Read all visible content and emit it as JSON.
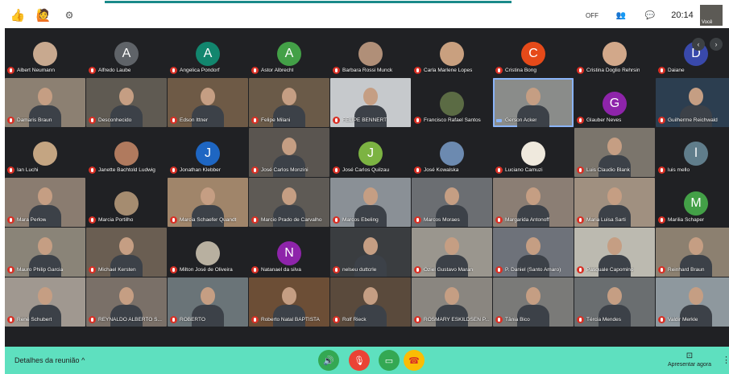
{
  "topbar": {
    "off_label": "OFF",
    "time": "20:14",
    "self_label": "Você"
  },
  "pager": {
    "prev": "‹",
    "next": "›"
  },
  "participants": [
    {
      "name": "Albert Neumann",
      "kind": "photo",
      "color": "#c8a98f"
    },
    {
      "name": "Alfredo Laube",
      "kind": "letter",
      "letter": "A",
      "color": "#5f6368"
    },
    {
      "name": "Angelica Pondorf",
      "kind": "letter",
      "letter": "A",
      "color": "#12866e"
    },
    {
      "name": "Astor Albrecht",
      "kind": "letter",
      "letter": "A",
      "color": "#43a047"
    },
    {
      "name": "Barbara Rossi Munck",
      "kind": "photo",
      "color": "#b08f78"
    },
    {
      "name": "Carla Marlene Lopes",
      "kind": "photo",
      "color": "#c9a07f"
    },
    {
      "name": "Cristina Bong",
      "kind": "letter",
      "letter": "C",
      "color": "#e64a19"
    },
    {
      "name": "Cristina Doglio Rehrsin",
      "kind": "photo",
      "color": "#d2a88a"
    },
    {
      "name": "Daiane",
      "kind": "letter",
      "letter": "D",
      "color": "#3949ab"
    },
    {
      "name": "Damaris Braun",
      "kind": "video",
      "color": "#8c8072"
    },
    {
      "name": "Desconhecido",
      "kind": "video",
      "color": "#5f5a52"
    },
    {
      "name": "Edson Ittner",
      "kind": "video",
      "color": "#6e5a46"
    },
    {
      "name": "Felipe Milani",
      "kind": "video",
      "color": "#6a5a48"
    },
    {
      "name": "FELIPE BENNERT",
      "kind": "video",
      "color": "#c6c9cc"
    },
    {
      "name": "Francisco Rafael Santos",
      "kind": "photo",
      "color": "#5b6b44"
    },
    {
      "name": "Gerson Acker",
      "kind": "video",
      "color": "#8a8c8a",
      "speaking": true
    },
    {
      "name": "Glauber Neves",
      "kind": "letter",
      "letter": "G",
      "color": "#8e24aa"
    },
    {
      "name": "Guilherme Reichwald",
      "kind": "video",
      "color": "#2c3e50"
    },
    {
      "name": "Ian Luchi",
      "kind": "photo",
      "color": "#c4a582"
    },
    {
      "name": "Janette Bachtold Ludwig",
      "kind": "photo",
      "color": "#b07a5e"
    },
    {
      "name": "Jonathan Klebber",
      "kind": "letter",
      "letter": "J",
      "color": "#1e66c2"
    },
    {
      "name": "José Carlos Monzini",
      "kind": "video",
      "color": "#5a5550"
    },
    {
      "name": "José Carlos Quilzau",
      "kind": "letter",
      "letter": "J",
      "color": "#7cb342"
    },
    {
      "name": "José Kowalska",
      "kind": "photo",
      "color": "#6c8ab0"
    },
    {
      "name": "Luciano Camuzi",
      "kind": "photo",
      "color": "#efe9dd"
    },
    {
      "name": "Luis Claudio Blank",
      "kind": "video",
      "color": "#7b756c"
    },
    {
      "name": "luis mello",
      "kind": "letter",
      "letter": "l",
      "color": "#607d8b"
    },
    {
      "name": "Mara Perlow",
      "kind": "video",
      "color": "#8a7c70"
    },
    {
      "name": "Marcia Portilho",
      "kind": "photo",
      "color": "#a58c70"
    },
    {
      "name": "Marcia Schaefer Quandt",
      "kind": "video",
      "color": "#a0856a"
    },
    {
      "name": "Marcio Prado de Carvalho",
      "kind": "video",
      "color": "#5e5a55"
    },
    {
      "name": "Marcos Ebeling",
      "kind": "video",
      "color": "#8a9096"
    },
    {
      "name": "Marcos Moraes",
      "kind": "video",
      "color": "#6b6e72"
    },
    {
      "name": "Margarida Antonoff",
      "kind": "video",
      "color": "#8b7e74"
    },
    {
      "name": "Maria Luisa Sarti",
      "kind": "video",
      "color": "#a09080"
    },
    {
      "name": "Marilia Schaper",
      "kind": "letter",
      "letter": "M",
      "color": "#43a047"
    },
    {
      "name": "Mauro Philip Garcia",
      "kind": "video",
      "color": "#8a8478"
    },
    {
      "name": "Michael Kersten",
      "kind": "video",
      "color": "#6a5e52"
    },
    {
      "name": "Milton José de Oliveira",
      "kind": "photo",
      "color": "#b8b0a0"
    },
    {
      "name": "Natanael da silva",
      "kind": "letter",
      "letter": "N",
      "color": "#8e24aa"
    },
    {
      "name": "nelseu duttcrle",
      "kind": "video",
      "color": "#3a3d40"
    },
    {
      "name": "Oziel Gustavo Maran",
      "kind": "video",
      "color": "#9a968e"
    },
    {
      "name": "P. Daniel (Santo Amaro)",
      "kind": "video",
      "color": "#6e727a"
    },
    {
      "name": "Pasquale Capomino",
      "kind": "video",
      "color": "#bcbab0"
    },
    {
      "name": "Reinhard Braun",
      "kind": "video",
      "color": "#8c8070"
    },
    {
      "name": "René Schubert",
      "kind": "video",
      "color": "#a09890"
    },
    {
      "name": "REYNALDO ALBERTO S...",
      "kind": "video",
      "color": "#7a7068"
    },
    {
      "name": "ROBERTO",
      "kind": "video",
      "color": "#6a7478"
    },
    {
      "name": "Roberto Natal BAPTISTA",
      "kind": "video",
      "color": "#6c4e36"
    },
    {
      "name": "Rolf Rieck",
      "kind": "video",
      "color": "#5a4a3c"
    },
    {
      "name": "ROSMARY ESKILDSEN P...",
      "kind": "video",
      "color": "#8a8680"
    },
    {
      "name": "Tânia Bico",
      "kind": "video",
      "color": "#7a7a78"
    },
    {
      "name": "Tércia Mendes",
      "kind": "video",
      "color": "#6a6e70"
    },
    {
      "name": "Valdir Merkle",
      "kind": "video",
      "color": "#8e989e"
    }
  ],
  "bottombar": {
    "details_label": "Detalhes da reunião",
    "details_chevron": "^",
    "present_label": "Apresentar agora"
  }
}
